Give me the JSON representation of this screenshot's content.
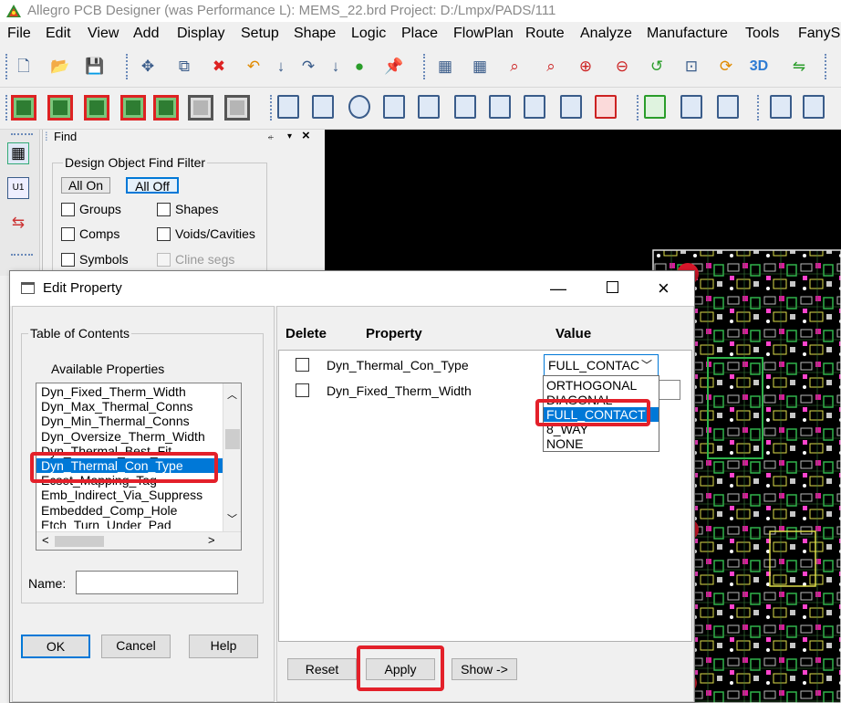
{
  "window": {
    "title": "Allegro PCB Designer (was Performance L): MEMS_22.brd  Project: D:/Lmpx/PADS/111"
  },
  "menu": [
    "File",
    "Edit",
    "View",
    "Add",
    "Display",
    "Setup",
    "Shape",
    "Logic",
    "Place",
    "FlowPlan",
    "Route",
    "Analyze",
    "Manufacture",
    "Tools",
    "FanySk"
  ],
  "toolbar_icons": {
    "row1": [
      "new-icon",
      "open-icon",
      "save-icon",
      "move-icon",
      "copy-icon",
      "delete-icon",
      "undo-icon",
      "down-arrow-icon",
      "redo-icon",
      "down-arrow-icon",
      "ratsnest-icon",
      "pin-icon",
      "grid-icon",
      "grid2-icon",
      "zoom-fit-icon",
      "zoom-icon",
      "zoom-in-icon",
      "zoom-out-icon",
      "zoom-prev-icon",
      "zoom-world-icon",
      "refresh-icon",
      "3d-icon",
      "flip-icon"
    ],
    "row2": [
      "add-connect-icon",
      "slide-icon",
      "delay-tune-icon",
      "custom-smooth-icon",
      "vias-icon",
      "gray-box-icon",
      "gray-box-icon",
      "shape-corner-icon",
      "rect-icon",
      "circle-icon",
      "select-icon",
      "shape-poly-icon",
      "shape-void-icon",
      "square-icon",
      "circle-square-icon",
      "fill-icon",
      "delete-shape-icon",
      "fix-icon",
      "dimension-icon",
      "measure-icon",
      "odb-icon",
      "library-icon"
    ]
  },
  "find_panel": {
    "title": "Find",
    "pin": "⍅",
    "close": "×",
    "group_label": "Design Object Find Filter",
    "all_on": "All On",
    "all_off": "All Off",
    "items": [
      {
        "label": "Groups",
        "checked": false
      },
      {
        "label": "Shapes",
        "checked": false
      },
      {
        "label": "Comps",
        "checked": false
      },
      {
        "label": "Voids/Cavities",
        "checked": false
      },
      {
        "label": "Symbols",
        "checked": false
      },
      {
        "label": "Cline segs",
        "checked": false,
        "disabled": true
      }
    ]
  },
  "dialog": {
    "title": "Edit Property",
    "toc_label": "Table of Contents",
    "available_label": "Available Properties",
    "properties": [
      "Dyn_Fixed_Therm_Width",
      "Dyn_Max_Thermal_Conns",
      "Dyn_Min_Thermal_Conns",
      "Dyn_Oversize_Therm_Width",
      "Dyn_Thermal_Best_Fit",
      "Dyn_Thermal_Con_Type",
      "Ecset_Mapping_Tag",
      "Emb_Indirect_Via_Suppress",
      "Embedded_Comp_Hole",
      "Etch_Turn_Under_Pad"
    ],
    "selected_property": "Dyn_Thermal_Con_Type",
    "name_label": "Name:",
    "name_value": "",
    "ok": "OK",
    "cancel": "Cancel",
    "help": "Help",
    "col_delete": "Delete",
    "col_property": "Property",
    "col_value": "Value",
    "rows": [
      {
        "property": "Dyn_Thermal_Con_Type",
        "value": "FULL_CONTAC"
      },
      {
        "property": "Dyn_Fixed_Therm_Width",
        "value": ""
      }
    ],
    "dropdown_options": [
      "ORTHOGONAL",
      "DIAGONAL",
      "FULL_CONTACT",
      "8_WAY",
      "NONE"
    ],
    "dropdown_selected": "FULL_CONTACT",
    "reset": "Reset",
    "apply": "Apply",
    "show": "Show ->"
  },
  "colors": {
    "highlight": "#e3202a",
    "selection": "#0078d7",
    "canvas": "#000000"
  }
}
